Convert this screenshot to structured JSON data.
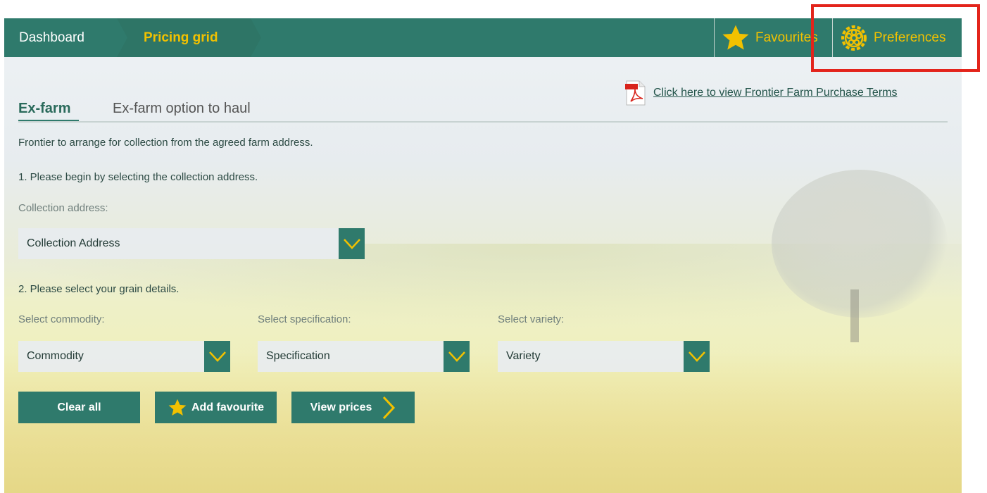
{
  "nav": {
    "dashboard": "Dashboard",
    "pricing_grid": "Pricing grid",
    "favourites": "Favourites",
    "preferences": "Preferences"
  },
  "tabs": {
    "ex_farm": "Ex-farm",
    "ex_farm_haul": "Ex-farm option to haul"
  },
  "terms_link": "Click here to view Frontier Farm Purchase Terms",
  "intro": "Frontier to arrange for collection from the agreed farm address.",
  "step1": "1. Please begin by selecting the collection address.",
  "collection": {
    "label": "Collection address:",
    "value": "Collection Address"
  },
  "step2": "2. Please select your grain details.",
  "commodity": {
    "label": "Select commodity:",
    "value": "Commodity"
  },
  "specification": {
    "label": "Select specification:",
    "value": "Specification"
  },
  "variety": {
    "label": "Select variety:",
    "value": "Variety"
  },
  "buttons": {
    "clear": "Clear all",
    "add_favourite": "Add favourite",
    "view_prices": "View prices"
  },
  "colors": {
    "primary": "#2f7a6c",
    "accent": "#f2c100",
    "highlight": "#e3241b"
  },
  "icons": [
    "star-icon",
    "gear-icon",
    "pdf-icon",
    "chevron-down-icon",
    "chevron-right-icon"
  ]
}
